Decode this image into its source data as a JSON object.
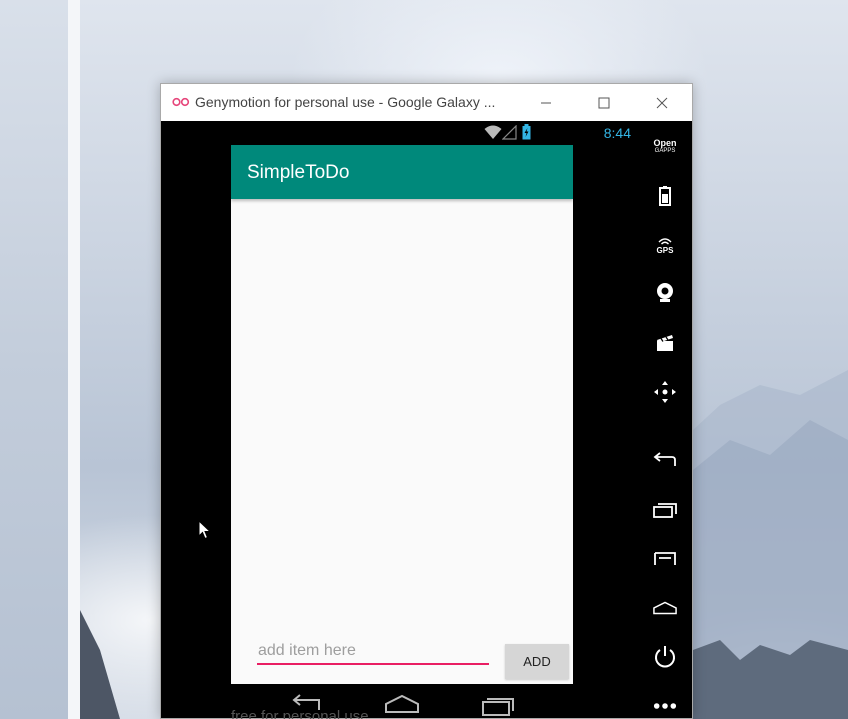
{
  "window": {
    "title": "Genymotion for personal use - Google Galaxy ...",
    "minimize_icon": "minimize-icon",
    "maximize_icon": "maximize-icon",
    "close_icon": "close-icon"
  },
  "statusbar": {
    "time": "8:44",
    "icons": [
      "wifi-icon",
      "signal-icon",
      "battery-charging-icon"
    ]
  },
  "app": {
    "title": "SimpleToDo",
    "input_placeholder": "add item here",
    "input_value": "",
    "add_button_label": "ADD",
    "items": []
  },
  "navbar": {
    "buttons": [
      "back-icon",
      "home-icon",
      "recents-icon"
    ]
  },
  "watermark": "free for personal use",
  "toolbar": {
    "opengapps_line1": "Open",
    "opengapps_line2": "GAPPS",
    "gps_label": "GPS",
    "tools": [
      "battery-icon",
      "gps-icon",
      "webcam-icon",
      "screencast-icon",
      "dpad-icon",
      "back-icon",
      "recent-apps-icon",
      "menu-icon",
      "home-icon",
      "power-icon",
      "more-icon"
    ]
  },
  "colors": {
    "appbar": "#00897b",
    "accent": "#e91e63",
    "clock": "#33b5e5"
  }
}
